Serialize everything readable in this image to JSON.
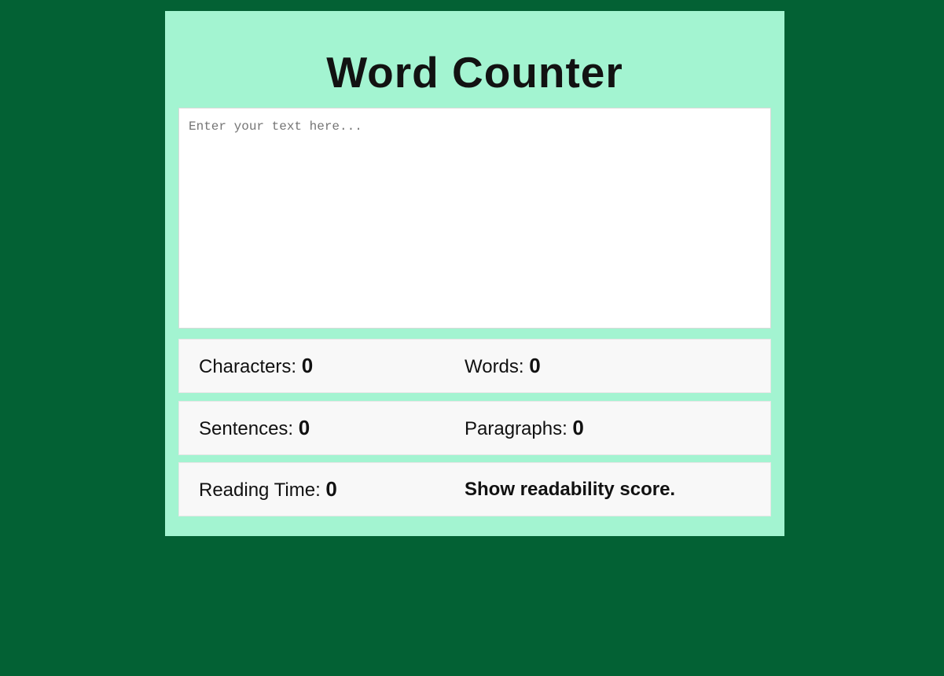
{
  "header": {
    "title": "Word Counter"
  },
  "editor": {
    "placeholder": "Enter your text here...",
    "value": ""
  },
  "stats": {
    "characters": {
      "label": "Characters: ",
      "value": "0"
    },
    "words": {
      "label": "Words: ",
      "value": "0"
    },
    "sentences": {
      "label": "Sentences: ",
      "value": "0"
    },
    "paragraphs": {
      "label": "Paragraphs: ",
      "value": "0"
    },
    "reading_time": {
      "label": "Reading Time: ",
      "value": "0"
    },
    "readability_link": "Show readability score."
  },
  "colors": {
    "background": "#036134",
    "card": "#a3f4d1",
    "stat_row": "#f8f8f8"
  }
}
